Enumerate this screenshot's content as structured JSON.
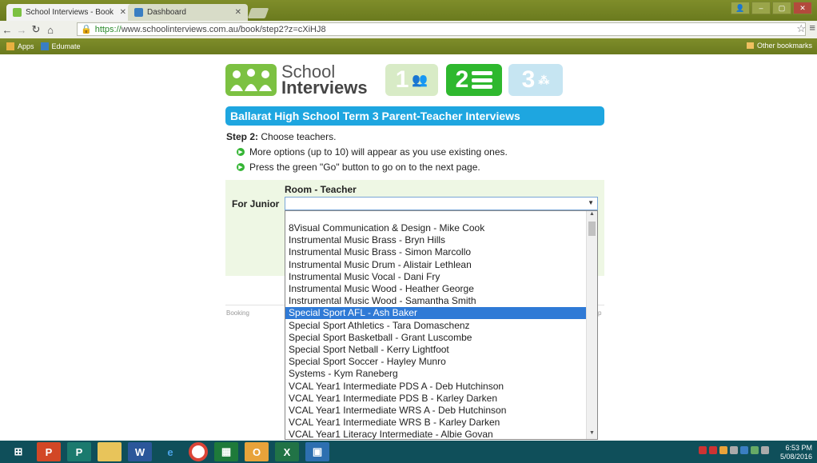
{
  "browser": {
    "tabs": [
      {
        "label": "School Interviews - Book",
        "active": true
      },
      {
        "label": "Dashboard",
        "active": false
      }
    ],
    "url_scheme": "https://",
    "url_rest": "www.schoolinterviews.com.au/book/step2?z=cXiHJ8",
    "bookmarks": [
      "Apps",
      "Edumate"
    ],
    "other_bookmarks": "Other bookmarks"
  },
  "logo": {
    "line1": "School",
    "line2": "Interviews"
  },
  "steps": [
    "1",
    "2",
    "3"
  ],
  "page": {
    "title": "Ballarat High School Term 3 Parent-Teacher Interviews",
    "step_bold": "Step 2:",
    "step_text": " Choose teachers.",
    "hints": [
      "More options (up to 10) will appear as you use existing ones.",
      "Press the green \"Go\" button to go on to the next page."
    ],
    "column_header": "Room - Teacher",
    "row_label": "For Junior",
    "select_value": "",
    "footer_left": "Booking",
    "footer_right": "p"
  },
  "dropdown": {
    "selected_index": 7,
    "options": [
      "8Visual Communication & Design - Mike Cook",
      "Instrumental Music Brass - Bryn Hills",
      "Instrumental Music Brass - Simon Marcollo",
      "Instrumental Music Drum - Alistair Lethlean",
      "Instrumental Music Vocal - Dani Fry",
      "Instrumental Music Wood - Heather George",
      "Instrumental Music Wood - Samantha Smith",
      "Special Sport AFL - Ash Baker",
      "Special Sport Athletics - Tara Domaschenz",
      "Special Sport Basketball - Grant Luscombe",
      "Special Sport Netball - Kerry Lightfoot",
      "Special Sport Soccer - Hayley Munro",
      "Systems - Kym Raneberg",
      "VCAL Year1 Intermediate PDS A - Deb Hutchinson",
      "VCAL Year1 Intermediate PDS B - Karley Darken",
      "VCAL Year1 Intermediate WRS A - Deb Hutchinson",
      "VCAL Year1 Intermediate WRS B - Karley Darken",
      "VCAL Year1 Literacy Intermediate - Albie Govan"
    ]
  },
  "taskbar": {
    "time": "6:53 PM",
    "date": "5/08/2016"
  },
  "colors": {
    "title_blue": "#1ea6e0",
    "step_green": "#2eb82e",
    "selected_blue": "#2f7ad6",
    "chrome_green": "#7f8d2a"
  }
}
